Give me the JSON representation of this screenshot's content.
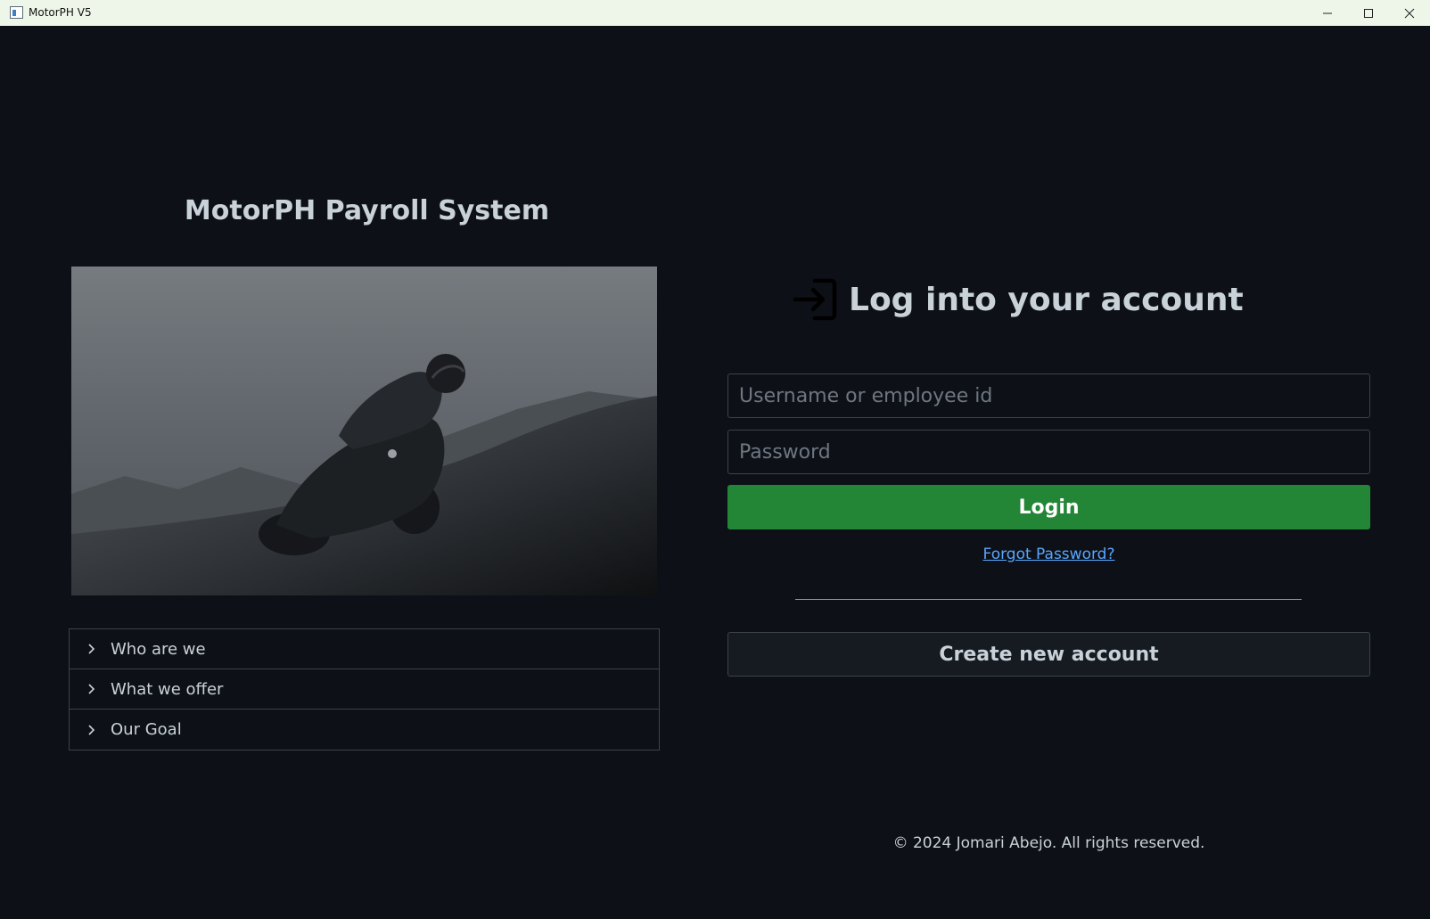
{
  "window": {
    "title": "MotorPH V5"
  },
  "left_panel": {
    "app_title": "MotorPH Payroll System",
    "hero_image": "motorcycle-rider-image",
    "accordion": [
      {
        "label": "Who are we"
      },
      {
        "label": "What we offer"
      },
      {
        "label": "Our Goal"
      }
    ]
  },
  "login": {
    "heading": "Log into your account",
    "heading_icon": "login-icon",
    "username_placeholder": "Username or employee id",
    "username_value": "",
    "password_placeholder": "Password",
    "password_value": "",
    "login_label": "Login",
    "forgot_label": "Forgot Password?",
    "create_label": "Create new account"
  },
  "footer": {
    "copyright": "© 2024 Jomari Abejo. All rights reserved."
  },
  "colors": {
    "background": "#0d1117",
    "text": "#c9d1d9",
    "primary_button": "#238636",
    "link": "#58a6ff",
    "border": "#3b424b"
  }
}
